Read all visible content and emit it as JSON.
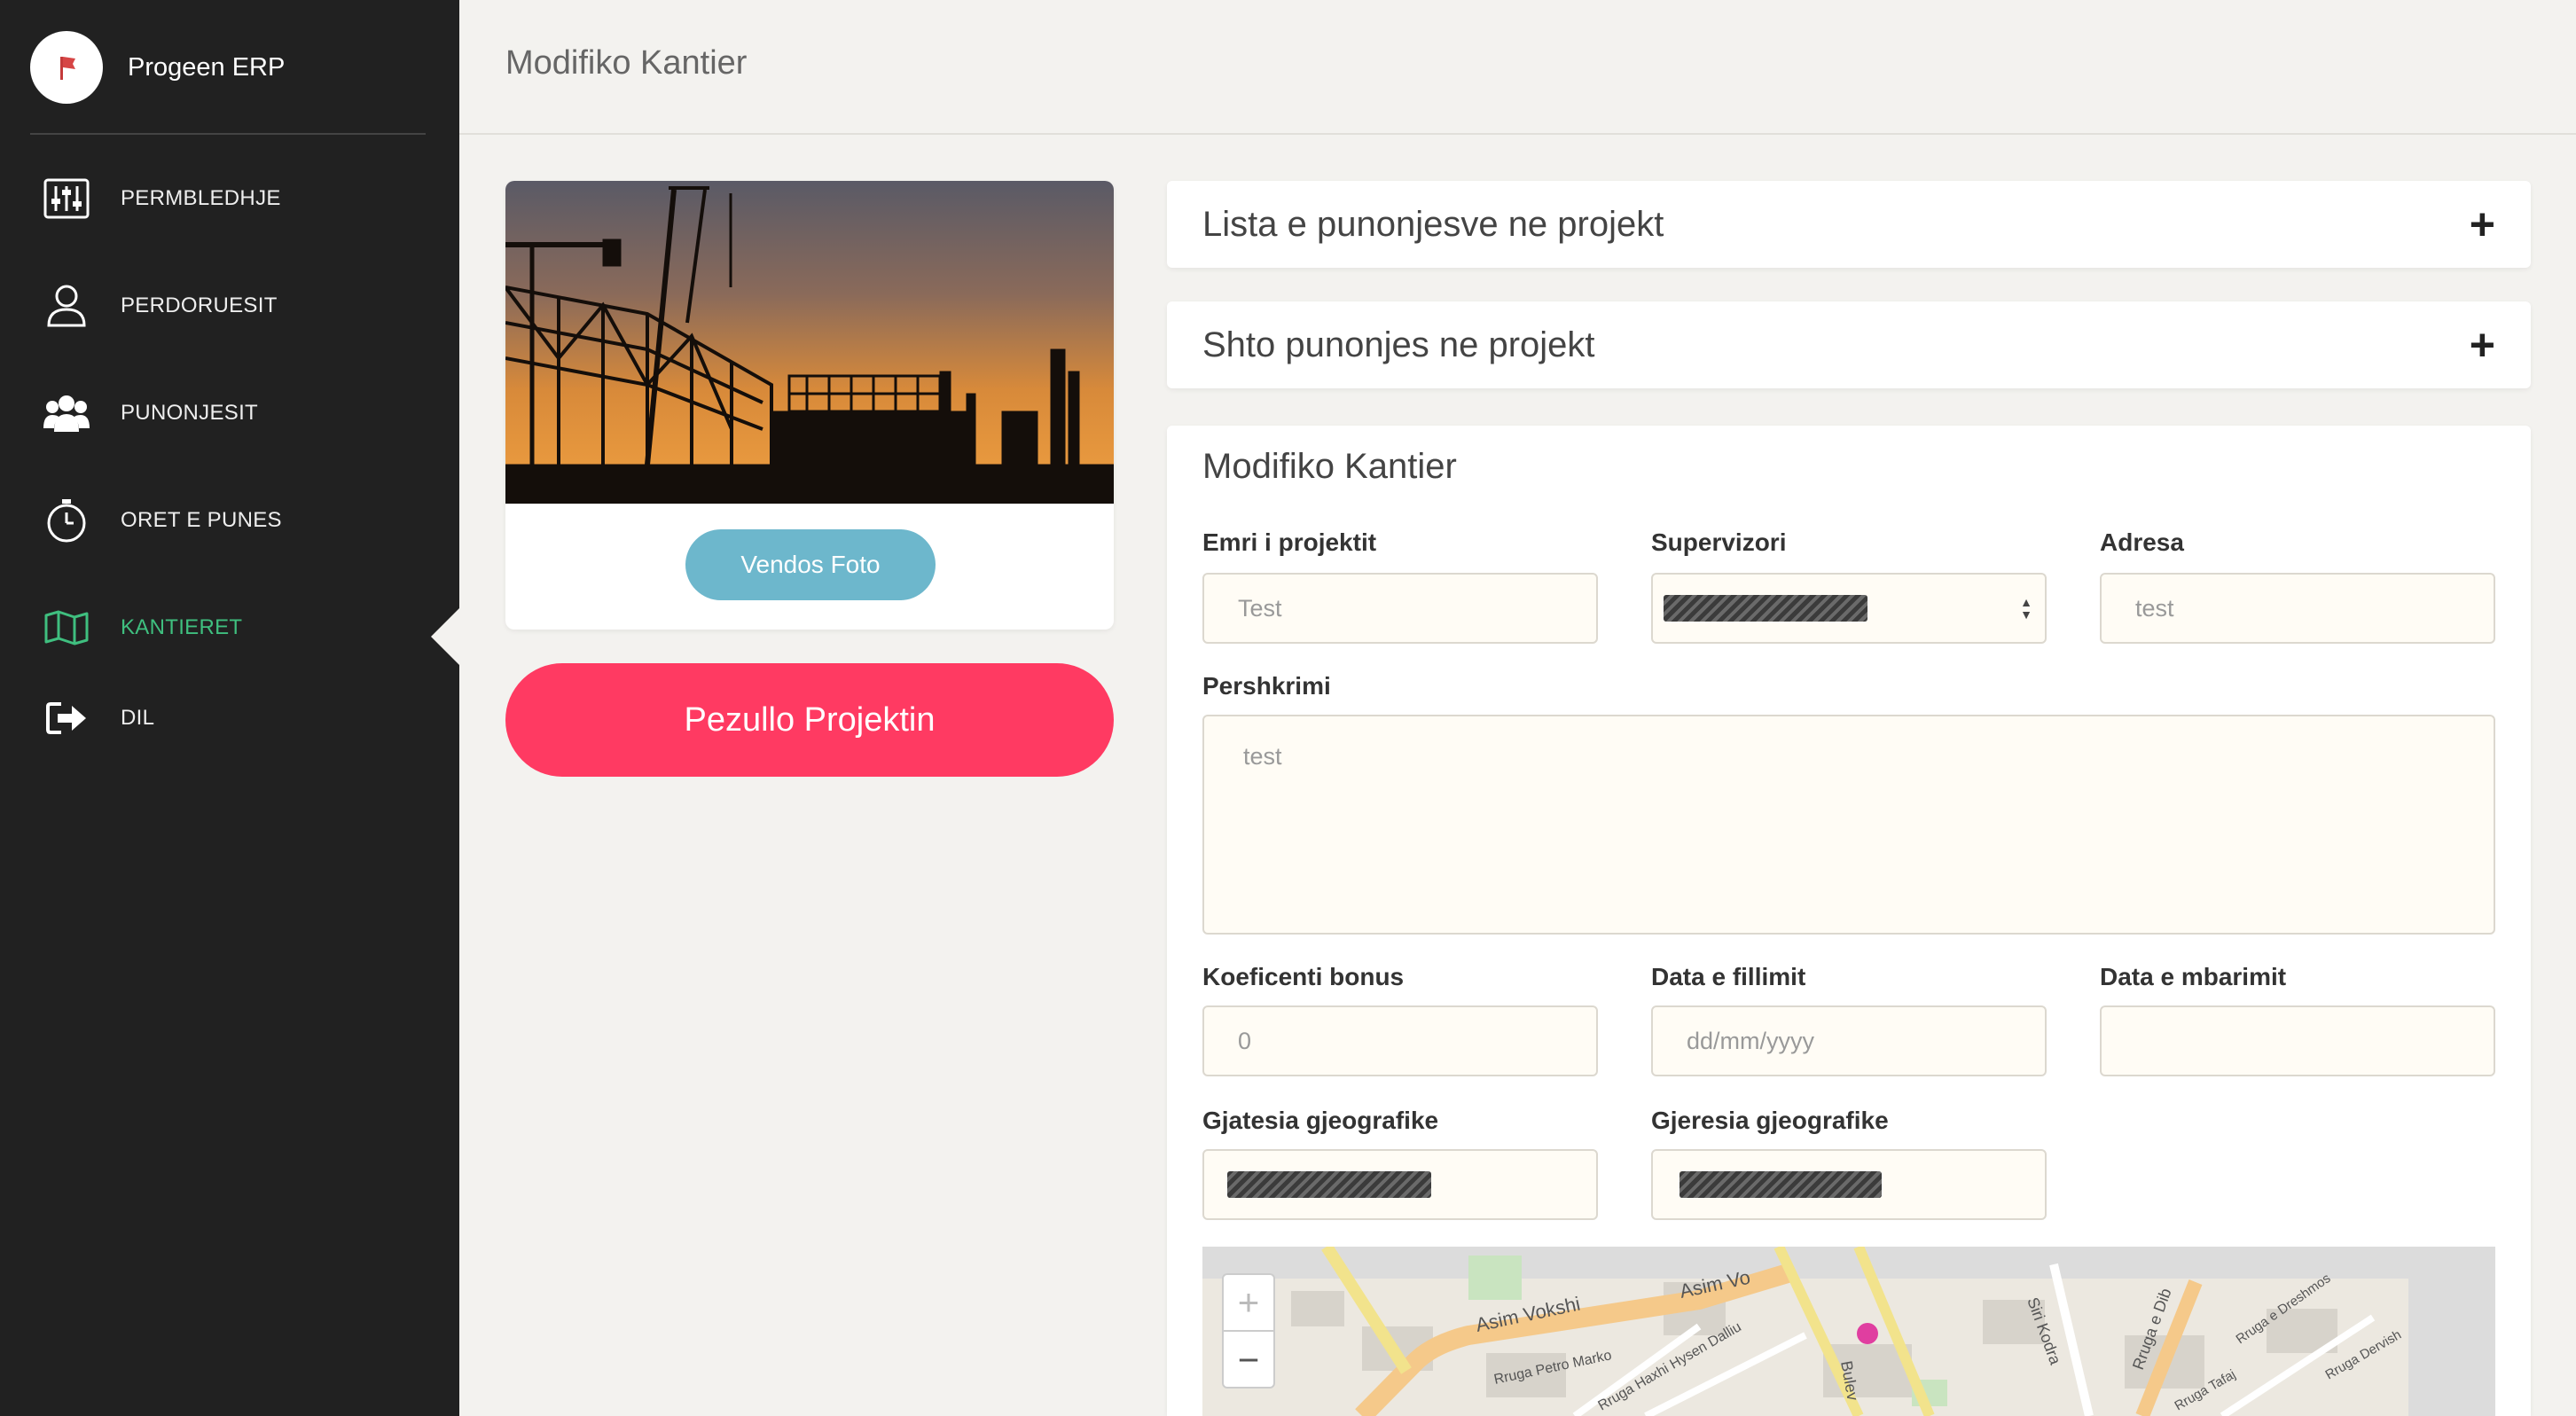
{
  "app": {
    "name": "Progeen ERP",
    "logo_icon": "flag-icon"
  },
  "sidebar": {
    "items": [
      {
        "label": "PERMBLEDHJE",
        "icon": "sliders-icon"
      },
      {
        "label": "PERDORUESIT",
        "icon": "user-icon"
      },
      {
        "label": "PUNONJESIT",
        "icon": "users-icon"
      },
      {
        "label": "ORET E PUNES",
        "icon": "stopwatch-icon"
      },
      {
        "label": "KANTIERET",
        "icon": "map-icon",
        "active": true
      },
      {
        "label": "DIL",
        "icon": "sign-out-icon"
      }
    ],
    "active_color": "#3fbf7f"
  },
  "header": {
    "title": "Modifiko Kantier"
  },
  "photo_card": {
    "upload_label": "Vendos Foto"
  },
  "suspend_button": {
    "label": "Pezullo Projektin",
    "color": "#ff3a62"
  },
  "panels": {
    "employees_list": {
      "title": "Lista e punonjesve ne projekt",
      "toggle": "+"
    },
    "add_employee": {
      "title": "Shto punonjes ne projekt",
      "toggle": "+"
    }
  },
  "form": {
    "title": "Modifiko Kantier",
    "project_name": {
      "label": "Emri i projektit",
      "value": "Test"
    },
    "supervisor": {
      "label": "Supervizori",
      "value": ""
    },
    "address": {
      "label": "Adresa",
      "value": "test"
    },
    "description": {
      "label": "Pershkrimi",
      "value": "test"
    },
    "bonus": {
      "label": "Koeficenti bonus",
      "value": "0"
    },
    "start_date": {
      "label": "Data e fillimit",
      "placeholder": "dd/mm/yyyy"
    },
    "end_date": {
      "label": "Data e mbarimit",
      "value": ""
    },
    "longitude": {
      "label": "Gjatesia gjeografike",
      "value": ""
    },
    "latitude": {
      "label": "Gjeresia gjeografike",
      "value": ""
    }
  },
  "map": {
    "zoom_in": "+",
    "zoom_out": "−",
    "streets": [
      "Asim Vokshi",
      "Asim Vo",
      "Rruga Petro Marko",
      "Rruga Haxhi Hysen Dalliu",
      "Siri Kodra",
      "Rruga e Dib",
      "Bulev",
      "Rruga e Dreshmos",
      "Rruga Tafaj",
      "Rruga Dervish"
    ]
  }
}
